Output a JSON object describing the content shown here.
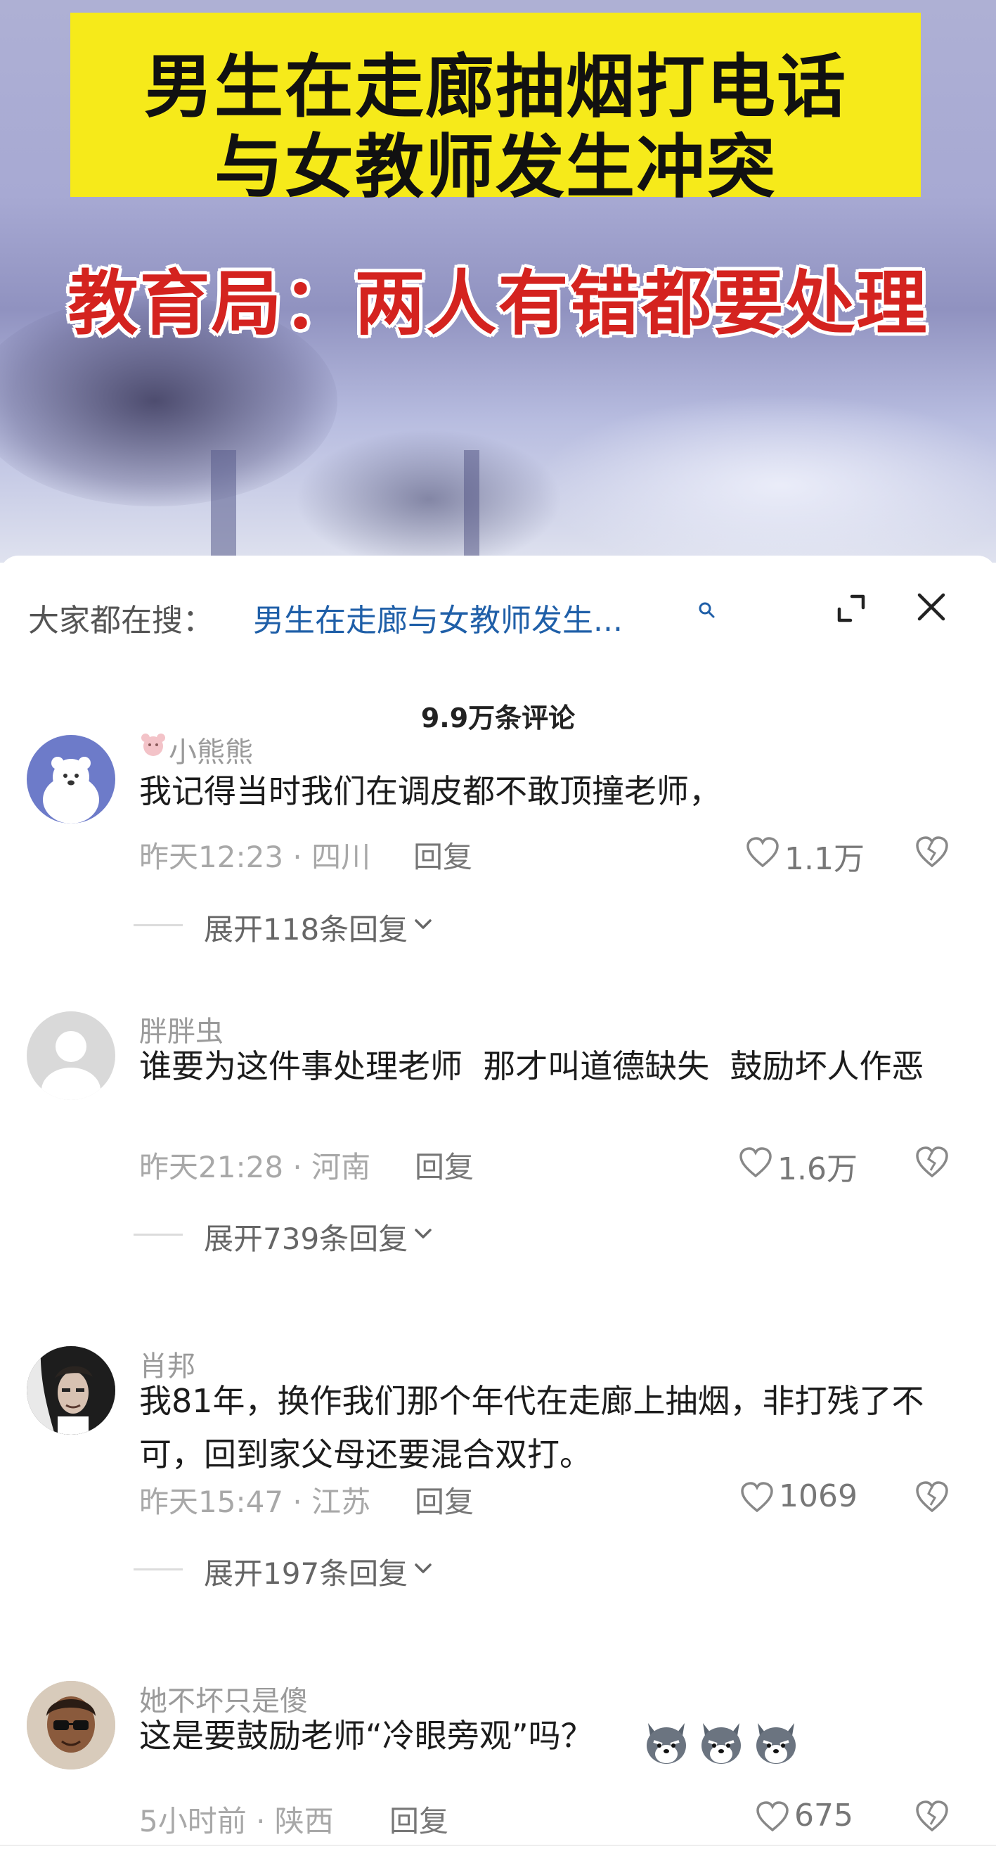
{
  "video": {
    "headline_line1": "男生在走廊抽烟打电话",
    "headline_line2": "与女教师发生冲突",
    "subheadline": "教育局：两人有错都要处理"
  },
  "search": {
    "prefix": "大家都在搜：",
    "query": "男生在走廊与女教师发生..."
  },
  "comments_header": {
    "count": "9.9万条评论"
  },
  "comments": [
    {
      "username": "小熊熊",
      "text": "我记得当时我们在调皮都不敢顶撞老师，",
      "time": "昨天12:23 · 四川",
      "reply": "回复",
      "likes": "1.1万",
      "expand": "展开118条回复"
    },
    {
      "username": "胖胖虫",
      "text": "谁要为这件事处理老师  那才叫道德缺失  鼓励坏人作恶",
      "time": "昨天21:28 · 河南",
      "reply": "回复",
      "likes": "1.6万",
      "expand": "展开739条回复"
    },
    {
      "username": "肖邦",
      "text": "我81年，换作我们那个年代在走廊上抽烟，非打残了不可，回到家父母还要混合双打。",
      "time": "昨天15:47 · 江苏",
      "reply": "回复",
      "likes": "1069",
      "expand": "展开197条回复"
    },
    {
      "username": "她不坏只是傻",
      "text": "这是要鼓励老师“冷眼旁观”吗？",
      "time": "5小时前 · 陕西",
      "reply": "回复",
      "likes": "675"
    }
  ],
  "icons": {
    "search": "search-icon",
    "expand": "expand-icon",
    "close": "close-icon",
    "like": "heart-icon",
    "dislike": "broken-heart-icon",
    "chevron": "chevron-down-icon",
    "emoji": "wolf-emoji-icon"
  },
  "colors": {
    "headline_bg": "#f6ea1a",
    "subheadline": "#d4231f",
    "search_link": "#1f5fa8"
  }
}
